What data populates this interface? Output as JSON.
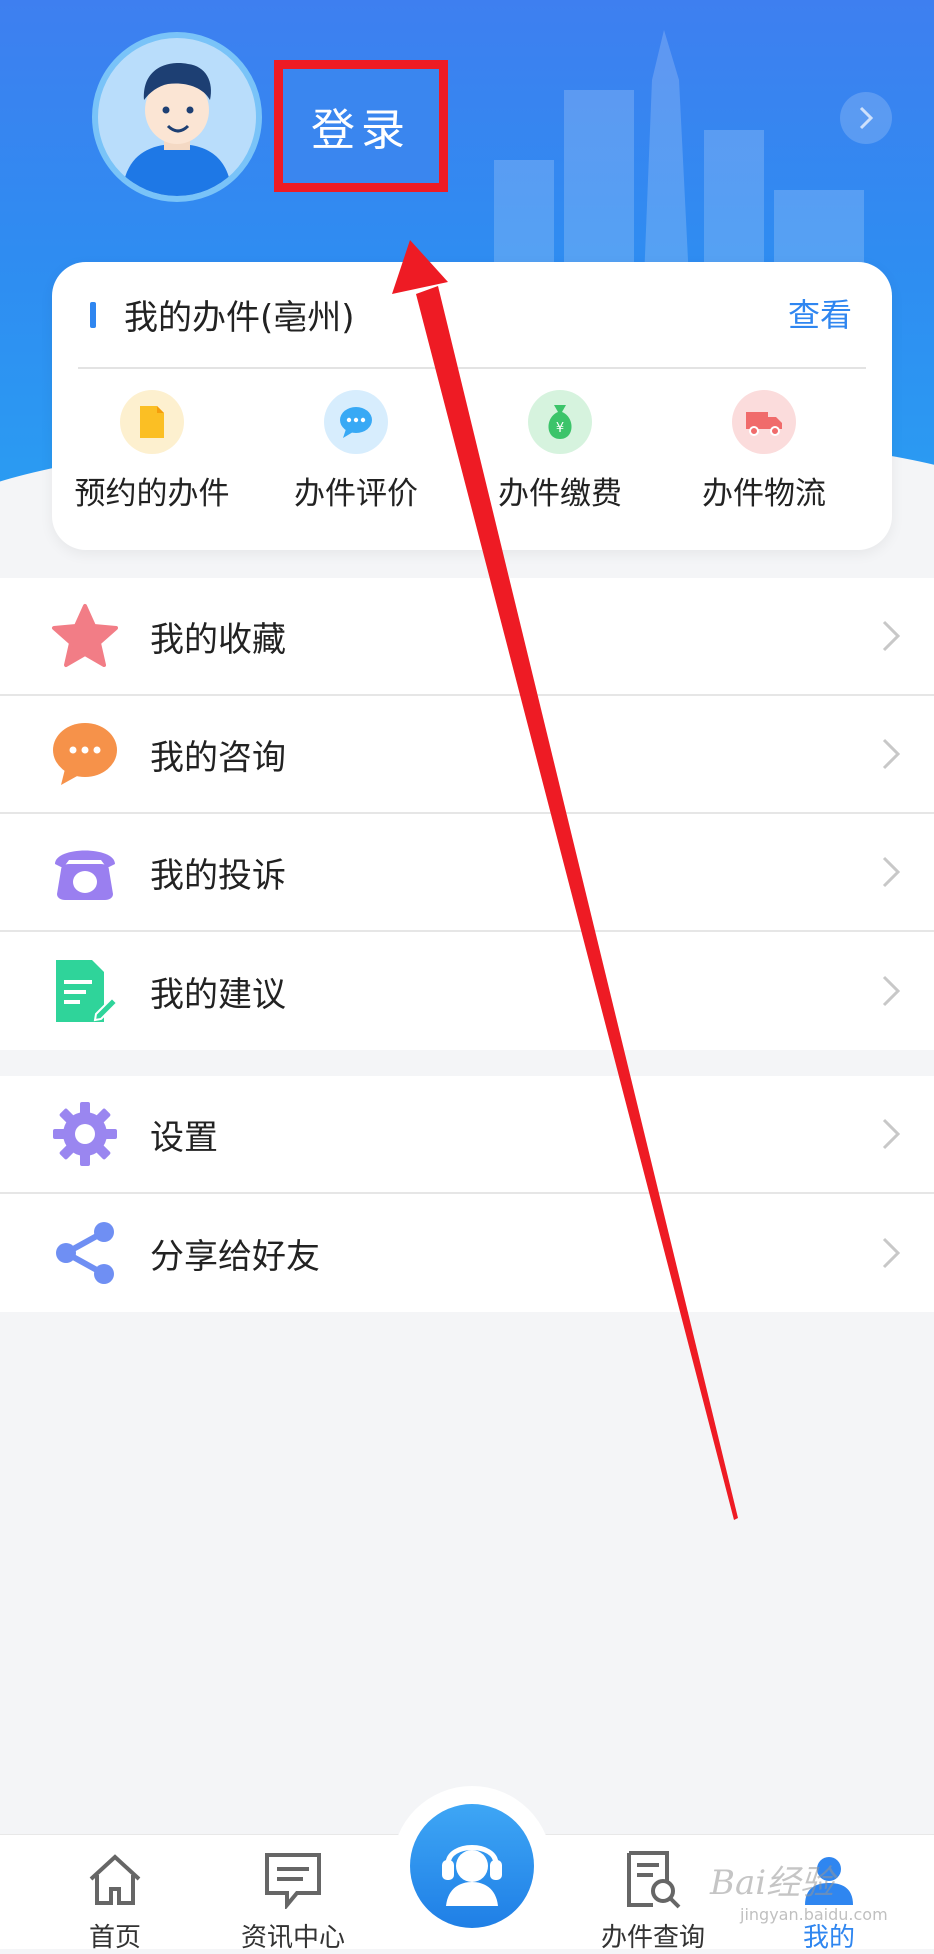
{
  "header": {
    "login_label": "登录"
  },
  "affairs_card": {
    "title": "我的办件(亳州)",
    "view_label": "查看",
    "items": [
      {
        "label": "预约的办件",
        "icon": "document-icon",
        "color": "#fbbf24"
      },
      {
        "label": "办件评价",
        "icon": "chat-bubble-icon",
        "color": "#38a9f5"
      },
      {
        "label": "办件缴费",
        "icon": "money-bag-icon",
        "color": "#3cc46a"
      },
      {
        "label": "办件物流",
        "icon": "truck-icon",
        "color": "#f06b6b"
      }
    ]
  },
  "menu_primary": [
    {
      "label": "我的收藏",
      "icon": "star-icon",
      "color": "#f27d86"
    },
    {
      "label": "我的咨询",
      "icon": "speech-bubble-icon",
      "color": "#f6924a"
    },
    {
      "label": "我的投诉",
      "icon": "telephone-icon",
      "color": "#9a7ff0"
    },
    {
      "label": "我的建议",
      "icon": "edit-document-icon",
      "color": "#2fd49a"
    }
  ],
  "menu_secondary": [
    {
      "label": "设置",
      "icon": "gear-icon",
      "color": "#9a86f0"
    },
    {
      "label": "分享给好友",
      "icon": "share-icon",
      "color": "#6f8ff3"
    }
  ],
  "tabbar": {
    "tabs": [
      {
        "label": "首页",
        "icon": "home-icon"
      },
      {
        "label": "资讯中心",
        "icon": "news-icon"
      },
      {
        "label": "办件查询",
        "icon": "search-document-icon"
      },
      {
        "label": "我的",
        "icon": "user-icon",
        "active": true
      }
    ],
    "center_icon": "customer-service-icon",
    "accent": "#2f86f0"
  },
  "watermark": {
    "brand": "Bai经验",
    "sub": "jingyan.baidu.com"
  }
}
